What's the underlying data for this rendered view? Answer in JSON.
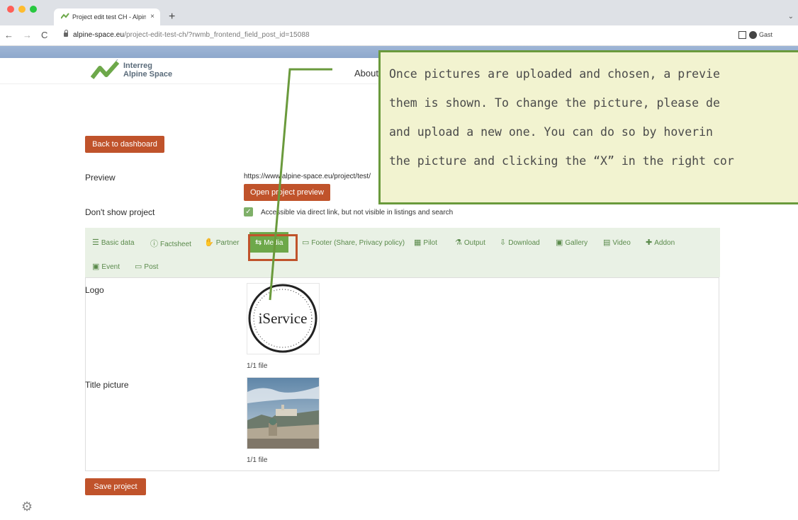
{
  "browser": {
    "tab_title": "Project edit test CH - Alpine S",
    "tab_close": "×",
    "new_tab": "+",
    "url_host": "alpine-space.eu",
    "url_path": "/project-edit-test-ch/?rwmb_frontend_field_post_id=15088",
    "profile_label": "Gast",
    "nav_back": "←",
    "nav_forward": "→",
    "nav_reload": "C"
  },
  "site": {
    "logo_line1": "Interreg",
    "logo_line2": "Alpine Space",
    "nav_about": "About"
  },
  "page": {
    "back_button": "Back to dashboard",
    "preview_label": "Preview",
    "preview_url": "https://www.alpine-space.eu/project/test/",
    "open_preview_button": "Open project preview",
    "dont_show_label": "Don't show project",
    "dont_show_checked": true,
    "dont_show_text": "Accessible via direct link, but not visible in listings and search",
    "save_button": "Save project"
  },
  "tabs": [
    {
      "label": "Basic data",
      "icon": "list-icon"
    },
    {
      "label": "Factsheet",
      "icon": "info-icon"
    },
    {
      "label": "Partner",
      "icon": "handshake-icon"
    },
    {
      "label": "Media",
      "icon": "media-icon",
      "active": true
    },
    {
      "label": "Footer (Share, Privacy policy)",
      "icon": "footer-icon"
    },
    {
      "label": "Pilot",
      "icon": "map-icon"
    },
    {
      "label": "Output",
      "icon": "flask-icon"
    },
    {
      "label": "Download",
      "icon": "download-icon"
    },
    {
      "label": "Gallery",
      "icon": "gallery-icon"
    },
    {
      "label": "Video",
      "icon": "video-icon"
    },
    {
      "label": "Addon",
      "icon": "addon-icon"
    },
    {
      "label": "Event",
      "icon": "calendar-icon"
    },
    {
      "label": "Post",
      "icon": "post-icon"
    }
  ],
  "media": {
    "logo_label": "Logo",
    "logo_image_text": "iService",
    "logo_file_count": "1/1 file",
    "title_picture_label": "Title picture",
    "title_file_count": "1/1 file"
  },
  "callout": {
    "line1": "Once pictures are uploaded and chosen, a previe",
    "line2": "them is shown. To change the picture, please de",
    "line3": "and upload a new one. You can do so by hoverin",
    "line4": "the picture and clicking the “X” in the right cor"
  },
  "colors": {
    "accent_button": "#c0532b",
    "tab_active": "#6da84a",
    "tab_bg": "#e9f1e5",
    "callout_border": "#6a9a3c",
    "callout_bg": "#f2f3d0"
  }
}
